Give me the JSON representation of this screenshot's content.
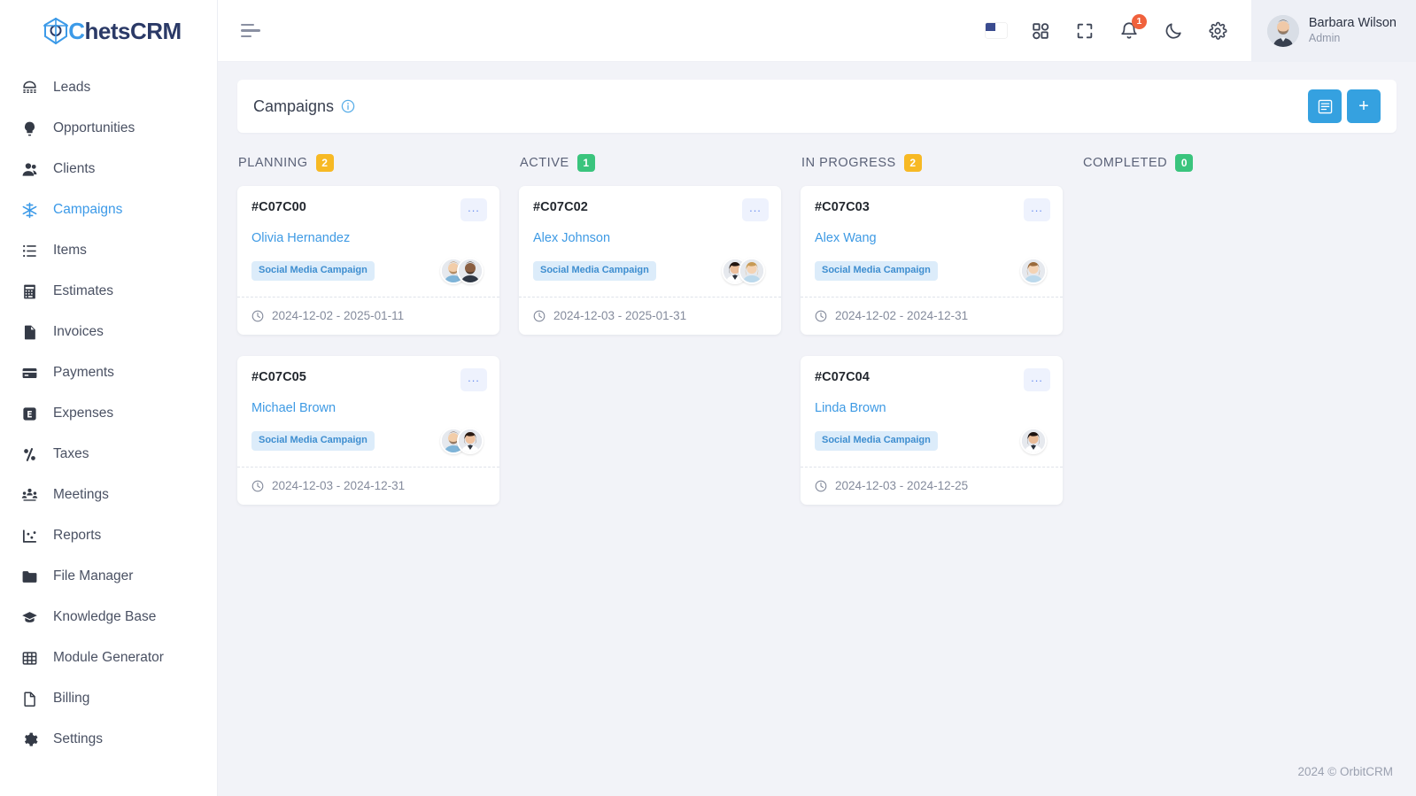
{
  "brand": {
    "logo_text_accent": "C",
    "logo_text_rest": "hetsCRM",
    "accent_color": "#3c9ae8",
    "primary_blue": "#35a1e0"
  },
  "sidebar": {
    "items": [
      {
        "label": "Leads",
        "icon": "phone-rotary-icon",
        "active": false
      },
      {
        "label": "Opportunities",
        "icon": "lightbulb-icon",
        "active": false
      },
      {
        "label": "Clients",
        "icon": "user-group-icon",
        "active": false
      },
      {
        "label": "Campaigns",
        "icon": "snowflake-icon",
        "active": true
      },
      {
        "label": "Items",
        "icon": "list-icon",
        "active": false
      },
      {
        "label": "Estimates",
        "icon": "calculator-icon",
        "active": false
      },
      {
        "label": "Invoices",
        "icon": "file-icon",
        "active": false
      },
      {
        "label": "Payments",
        "icon": "credit-card-icon",
        "active": false
      },
      {
        "label": "Expenses",
        "icon": "expense-icon",
        "active": false
      },
      {
        "label": "Taxes",
        "icon": "percent-icon",
        "active": false
      },
      {
        "label": "Meetings",
        "icon": "people-icon",
        "active": false
      },
      {
        "label": "Reports",
        "icon": "chart-icon",
        "active": false
      },
      {
        "label": "File Manager",
        "icon": "folder-icon",
        "active": false
      },
      {
        "label": "Knowledge Base",
        "icon": "graduation-cap-icon",
        "active": false
      },
      {
        "label": "Module Generator",
        "icon": "grid-table-icon",
        "active": false
      },
      {
        "label": "Billing",
        "icon": "document-icon",
        "active": false
      },
      {
        "label": "Settings",
        "icon": "gear-icon",
        "active": false
      }
    ]
  },
  "topbar": {
    "menu_toggle": "hamburger-icon",
    "icons": [
      {
        "name": "flag-us-icon"
      },
      {
        "name": "apps-grid-icon"
      },
      {
        "name": "fullscreen-icon"
      },
      {
        "name": "bell-icon",
        "badge": "1"
      },
      {
        "name": "moon-icon"
      },
      {
        "name": "gear-icon"
      }
    ],
    "notification_count": "1",
    "user": {
      "name": "Barbara Wilson",
      "role": "Admin"
    }
  },
  "page": {
    "title": "Campaigns",
    "info_tooltip_icon": "info-icon",
    "actions": [
      {
        "name": "list-view-button",
        "icon": "list-view-icon"
      },
      {
        "name": "add-campaign-button",
        "icon": "plus-icon",
        "label": "+"
      }
    ]
  },
  "board": {
    "columns": [
      {
        "title": "PLANNING",
        "count": "2",
        "badge_style": "warn",
        "cards": [
          {
            "id": "#C07C00",
            "owner": "Olivia Hernandez",
            "tag": "Social Media Campaign",
            "dates": "2024-12-02 - 2025-01-11",
            "menu": "...",
            "avatars": [
              "male-beard",
              "male-dark"
            ]
          },
          {
            "id": "#C07C05",
            "owner": "Michael Brown",
            "tag": "Social Media Campaign",
            "dates": "2024-12-03 - 2024-12-31",
            "menu": "...",
            "avatars": [
              "male-beard",
              "female-dark"
            ]
          }
        ]
      },
      {
        "title": "ACTIVE",
        "count": "1",
        "badge_style": "ok",
        "cards": [
          {
            "id": "#C07C02",
            "owner": "Alex Johnson",
            "tag": "Social Media Campaign",
            "dates": "2024-12-03 - 2025-01-31",
            "menu": "...",
            "avatars": [
              "female-dark",
              "female-blonde"
            ]
          }
        ]
      },
      {
        "title": "IN PROGRESS",
        "count": "2",
        "badge_style": "warn",
        "cards": [
          {
            "id": "#C07C03",
            "owner": "Alex Wang",
            "tag": "Social Media Campaign",
            "dates": "2024-12-02 - 2024-12-31",
            "menu": "...",
            "avatars": [
              "female-blonde"
            ]
          },
          {
            "id": "#C07C04",
            "owner": "Linda Brown",
            "tag": "Social Media Campaign",
            "dates": "2024-12-03 - 2024-12-25",
            "menu": "...",
            "avatars": [
              "female-dark"
            ]
          }
        ]
      },
      {
        "title": "COMPLETED",
        "count": "0",
        "badge_style": "ok",
        "cards": []
      }
    ]
  },
  "footer": {
    "copyright": "2024 © OrbitCRM"
  }
}
